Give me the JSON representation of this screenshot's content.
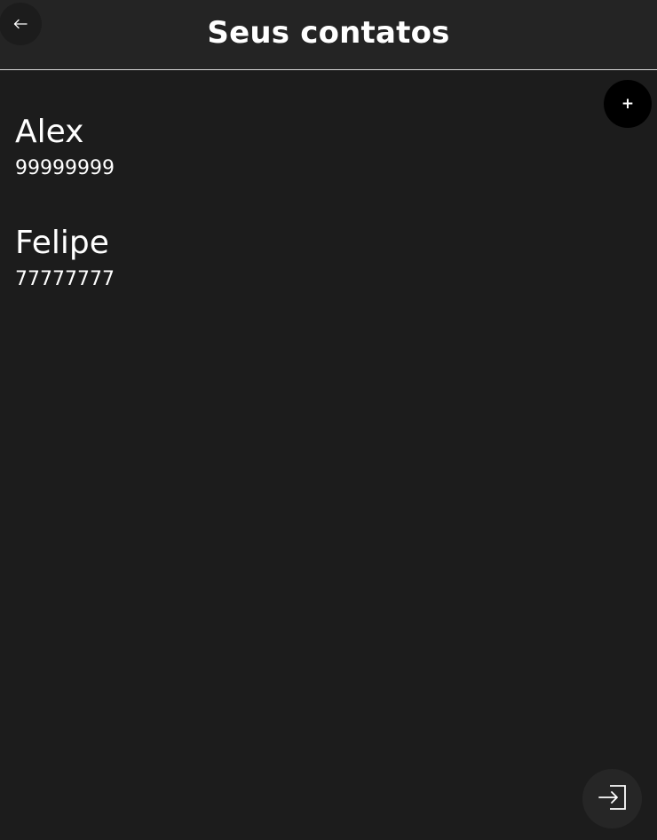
{
  "header": {
    "title": "Seus contatos",
    "back_icon": "arrow-left-icon"
  },
  "add_button": {
    "label": "+",
    "icon": "plus-icon"
  },
  "contacts": [
    {
      "name": "Alex",
      "phone": "99999999"
    },
    {
      "name": "Felipe",
      "phone": "77777777"
    }
  ],
  "logout_button": {
    "icon": "login-arrow-icon"
  },
  "colors": {
    "background": "#1c1c1c",
    "header": "#242424",
    "header_border": "#d8d8d8",
    "add_button": "#000000",
    "text": "#ffffff"
  }
}
